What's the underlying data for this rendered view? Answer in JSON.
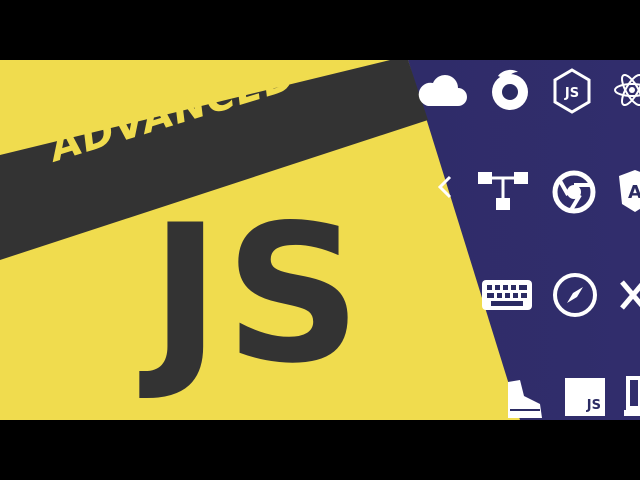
{
  "banner": {
    "advanced_label": "ADVANCED",
    "js_label": "JS"
  },
  "colors": {
    "js_yellow": "#f0dc4e",
    "dark_band": "#333333",
    "navy_panel": "#2a2a63",
    "icon_white": "#ffffff",
    "letterbox": "#000000"
  },
  "icons": [
    "cloud-icon",
    "firefox-icon",
    "nodejs-icon",
    "react-icon",
    "share-icon",
    "sitemap-icon",
    "chrome-icon",
    "angular-icon",
    "keyboard-icon",
    "safari-icon",
    "close-icon",
    "shoe-icon",
    "js-square-icon",
    "laptop-icon"
  ],
  "js_square_badge": "JS"
}
